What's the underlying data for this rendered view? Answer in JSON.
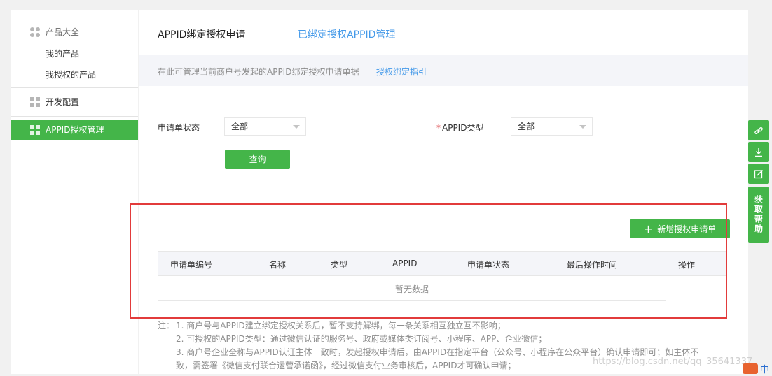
{
  "sidebar": {
    "products_head": "产品大全",
    "my_products": "我的产品",
    "authorized_products": "我授权的产品",
    "dev_config": "开发配置",
    "appid_manage": "APPID授权管理"
  },
  "header": {
    "title": "APPID绑定授权申请",
    "link": "已绑定授权APPID管理"
  },
  "info": {
    "text": "在此可管理当前商户号发起的APPID绑定授权申请单据",
    "link": "授权绑定指引"
  },
  "filters": {
    "status_label": "申请单状态",
    "status_value": "全部",
    "type_required": "*",
    "type_label": "APPID类型",
    "type_value": "全部",
    "query_button": "查询"
  },
  "new_button": "新增授权申请单",
  "table": {
    "columns": [
      "申请单编号",
      "名称",
      "类型",
      "APPID",
      "申请单状态",
      "最后操作时间",
      "操作"
    ],
    "empty": "暂无数据"
  },
  "notes": {
    "lead": "注：",
    "lines": [
      "1. 商户号与APPID建立绑定授权关系后，暂不支持解绑，每一条关系相互独立互不影响；",
      "2. 可授权的APPID类型：通过微信认证的服务号、政府或媒体类订阅号、小程序、APP、企业微信；",
      "3. 商户号企业全称与APPID认证主体一致时，发起授权申请后，由APPID在指定平台（公众号、小程序在公众平台）确认申请即可；如主体不一",
      "致，需签署《微信支付联合运营承诺函》，经过微信支付业务审核后，APPID才可确认申请；"
    ]
  },
  "float_tools": {
    "help": "获取帮助",
    "icons": [
      "link-icon",
      "download-icon",
      "edit-icon"
    ]
  },
  "watermark": "https://blog.csdn.net/qq_35641337",
  "colors": {
    "green": "#44b549",
    "link_blue": "#459ae9",
    "highlight_red": "#e23b3b"
  }
}
